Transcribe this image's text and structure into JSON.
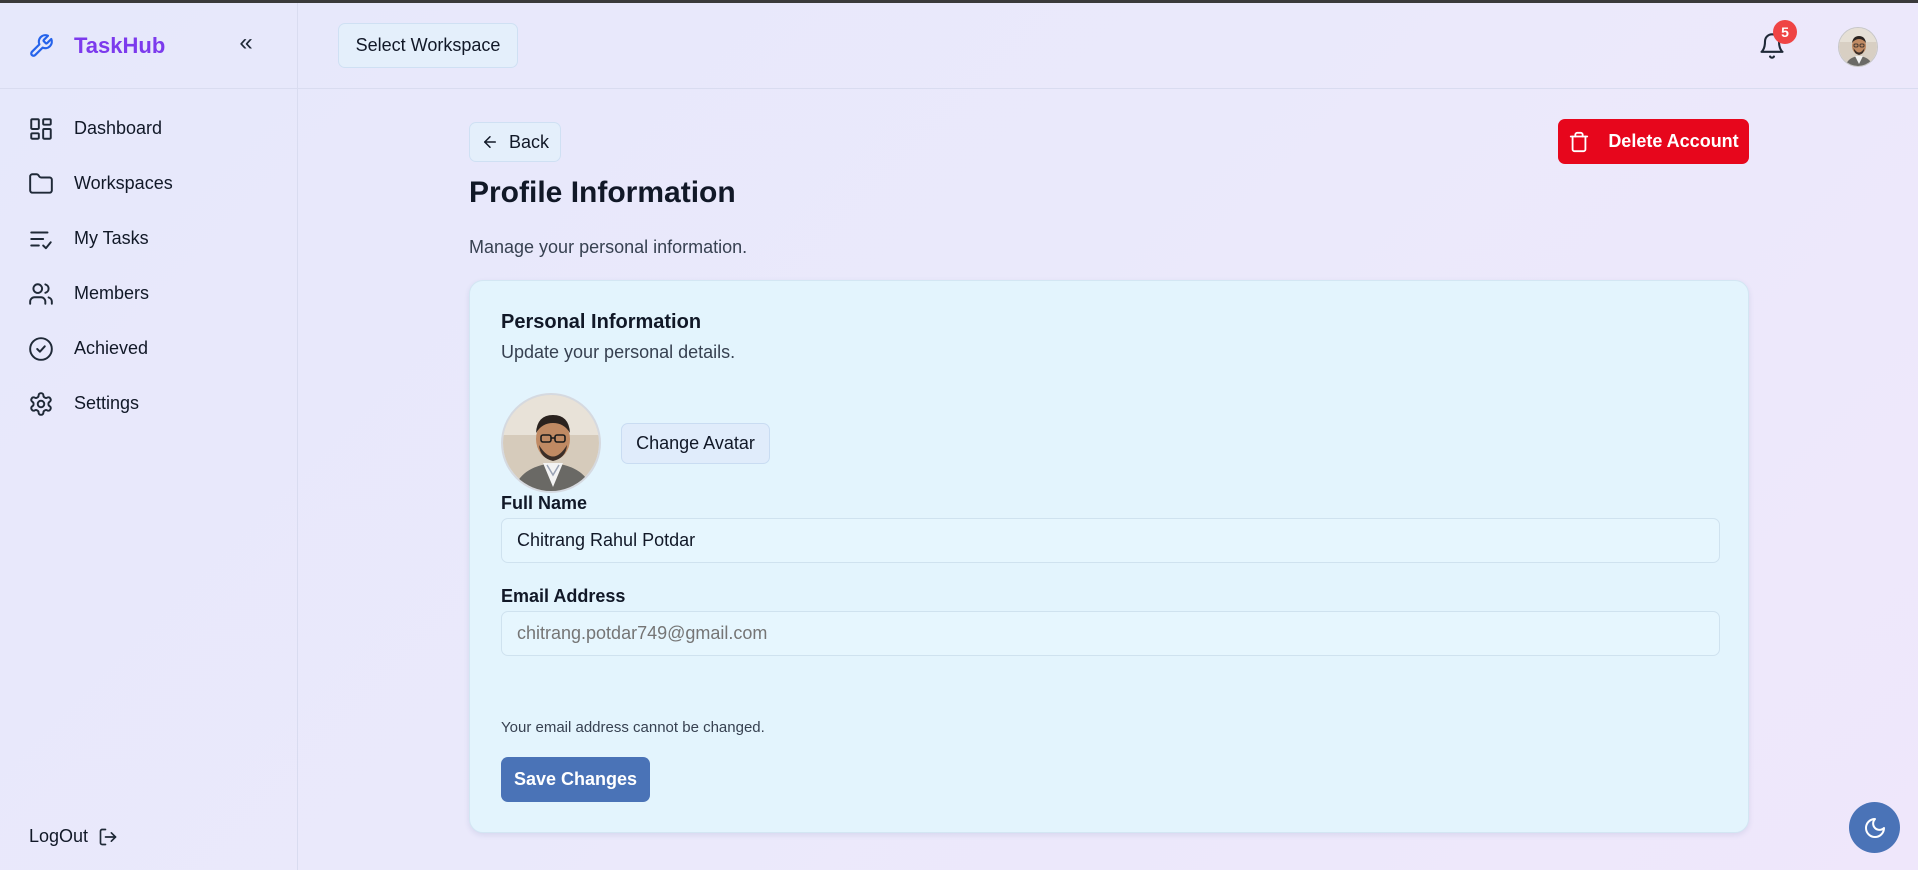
{
  "app": {
    "name": "TaskHub",
    "brand_color": "#7c3aed"
  },
  "sidebar": {
    "collapse_icon": "«",
    "items": [
      {
        "label": "Dashboard",
        "icon": "dashboard-icon"
      },
      {
        "label": "Workspaces",
        "icon": "folder-icon"
      },
      {
        "label": "My Tasks",
        "icon": "list-check-icon"
      },
      {
        "label": "Members",
        "icon": "users-icon"
      },
      {
        "label": "Achieved",
        "icon": "check-circle-icon"
      },
      {
        "label": "Settings",
        "icon": "gear-icon"
      }
    ],
    "logout_label": "LogOut"
  },
  "header": {
    "workspace_button": "Select Workspace",
    "notification_count": "5"
  },
  "page": {
    "back_label": "Back",
    "delete_label": "Delete Account",
    "title": "Profile Information",
    "subtitle": "Manage your personal information."
  },
  "card": {
    "title": "Personal Information",
    "subtitle": "Update your personal details.",
    "change_avatar_label": "Change Avatar",
    "full_name_label": "Full Name",
    "full_name_value": "Chitrang Rahul Potdar",
    "email_label": "Email Address",
    "email_value": "chitrang.potdar749@gmail.com",
    "email_hint": "Your email address cannot be changed.",
    "save_label": "Save Changes"
  },
  "colors": {
    "danger": "#e7061c",
    "primary": "#4a73b7",
    "badge": "#ef4444"
  }
}
